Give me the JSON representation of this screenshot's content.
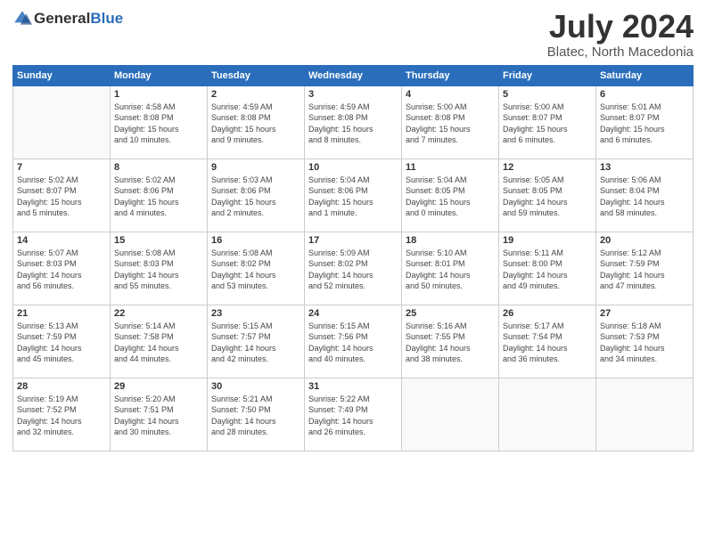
{
  "header": {
    "logo_general": "General",
    "logo_blue": "Blue",
    "main_title": "July 2024",
    "sub_title": "Blatec, North Macedonia"
  },
  "days_of_week": [
    "Sunday",
    "Monday",
    "Tuesday",
    "Wednesday",
    "Thursday",
    "Friday",
    "Saturday"
  ],
  "weeks": [
    [
      {
        "day": "",
        "info": ""
      },
      {
        "day": "1",
        "info": "Sunrise: 4:58 AM\nSunset: 8:08 PM\nDaylight: 15 hours\nand 10 minutes."
      },
      {
        "day": "2",
        "info": "Sunrise: 4:59 AM\nSunset: 8:08 PM\nDaylight: 15 hours\nand 9 minutes."
      },
      {
        "day": "3",
        "info": "Sunrise: 4:59 AM\nSunset: 8:08 PM\nDaylight: 15 hours\nand 8 minutes."
      },
      {
        "day": "4",
        "info": "Sunrise: 5:00 AM\nSunset: 8:08 PM\nDaylight: 15 hours\nand 7 minutes."
      },
      {
        "day": "5",
        "info": "Sunrise: 5:00 AM\nSunset: 8:07 PM\nDaylight: 15 hours\nand 6 minutes."
      },
      {
        "day": "6",
        "info": "Sunrise: 5:01 AM\nSunset: 8:07 PM\nDaylight: 15 hours\nand 6 minutes."
      }
    ],
    [
      {
        "day": "7",
        "info": "Sunrise: 5:02 AM\nSunset: 8:07 PM\nDaylight: 15 hours\nand 5 minutes."
      },
      {
        "day": "8",
        "info": "Sunrise: 5:02 AM\nSunset: 8:06 PM\nDaylight: 15 hours\nand 4 minutes."
      },
      {
        "day": "9",
        "info": "Sunrise: 5:03 AM\nSunset: 8:06 PM\nDaylight: 15 hours\nand 2 minutes."
      },
      {
        "day": "10",
        "info": "Sunrise: 5:04 AM\nSunset: 8:06 PM\nDaylight: 15 hours\nand 1 minute."
      },
      {
        "day": "11",
        "info": "Sunrise: 5:04 AM\nSunset: 8:05 PM\nDaylight: 15 hours\nand 0 minutes."
      },
      {
        "day": "12",
        "info": "Sunrise: 5:05 AM\nSunset: 8:05 PM\nDaylight: 14 hours\nand 59 minutes."
      },
      {
        "day": "13",
        "info": "Sunrise: 5:06 AM\nSunset: 8:04 PM\nDaylight: 14 hours\nand 58 minutes."
      }
    ],
    [
      {
        "day": "14",
        "info": "Sunrise: 5:07 AM\nSunset: 8:03 PM\nDaylight: 14 hours\nand 56 minutes."
      },
      {
        "day": "15",
        "info": "Sunrise: 5:08 AM\nSunset: 8:03 PM\nDaylight: 14 hours\nand 55 minutes."
      },
      {
        "day": "16",
        "info": "Sunrise: 5:08 AM\nSunset: 8:02 PM\nDaylight: 14 hours\nand 53 minutes."
      },
      {
        "day": "17",
        "info": "Sunrise: 5:09 AM\nSunset: 8:02 PM\nDaylight: 14 hours\nand 52 minutes."
      },
      {
        "day": "18",
        "info": "Sunrise: 5:10 AM\nSunset: 8:01 PM\nDaylight: 14 hours\nand 50 minutes."
      },
      {
        "day": "19",
        "info": "Sunrise: 5:11 AM\nSunset: 8:00 PM\nDaylight: 14 hours\nand 49 minutes."
      },
      {
        "day": "20",
        "info": "Sunrise: 5:12 AM\nSunset: 7:59 PM\nDaylight: 14 hours\nand 47 minutes."
      }
    ],
    [
      {
        "day": "21",
        "info": "Sunrise: 5:13 AM\nSunset: 7:59 PM\nDaylight: 14 hours\nand 45 minutes."
      },
      {
        "day": "22",
        "info": "Sunrise: 5:14 AM\nSunset: 7:58 PM\nDaylight: 14 hours\nand 44 minutes."
      },
      {
        "day": "23",
        "info": "Sunrise: 5:15 AM\nSunset: 7:57 PM\nDaylight: 14 hours\nand 42 minutes."
      },
      {
        "day": "24",
        "info": "Sunrise: 5:15 AM\nSunset: 7:56 PM\nDaylight: 14 hours\nand 40 minutes."
      },
      {
        "day": "25",
        "info": "Sunrise: 5:16 AM\nSunset: 7:55 PM\nDaylight: 14 hours\nand 38 minutes."
      },
      {
        "day": "26",
        "info": "Sunrise: 5:17 AM\nSunset: 7:54 PM\nDaylight: 14 hours\nand 36 minutes."
      },
      {
        "day": "27",
        "info": "Sunrise: 5:18 AM\nSunset: 7:53 PM\nDaylight: 14 hours\nand 34 minutes."
      }
    ],
    [
      {
        "day": "28",
        "info": "Sunrise: 5:19 AM\nSunset: 7:52 PM\nDaylight: 14 hours\nand 32 minutes."
      },
      {
        "day": "29",
        "info": "Sunrise: 5:20 AM\nSunset: 7:51 PM\nDaylight: 14 hours\nand 30 minutes."
      },
      {
        "day": "30",
        "info": "Sunrise: 5:21 AM\nSunset: 7:50 PM\nDaylight: 14 hours\nand 28 minutes."
      },
      {
        "day": "31",
        "info": "Sunrise: 5:22 AM\nSunset: 7:49 PM\nDaylight: 14 hours\nand 26 minutes."
      },
      {
        "day": "",
        "info": ""
      },
      {
        "day": "",
        "info": ""
      },
      {
        "day": "",
        "info": ""
      }
    ]
  ]
}
